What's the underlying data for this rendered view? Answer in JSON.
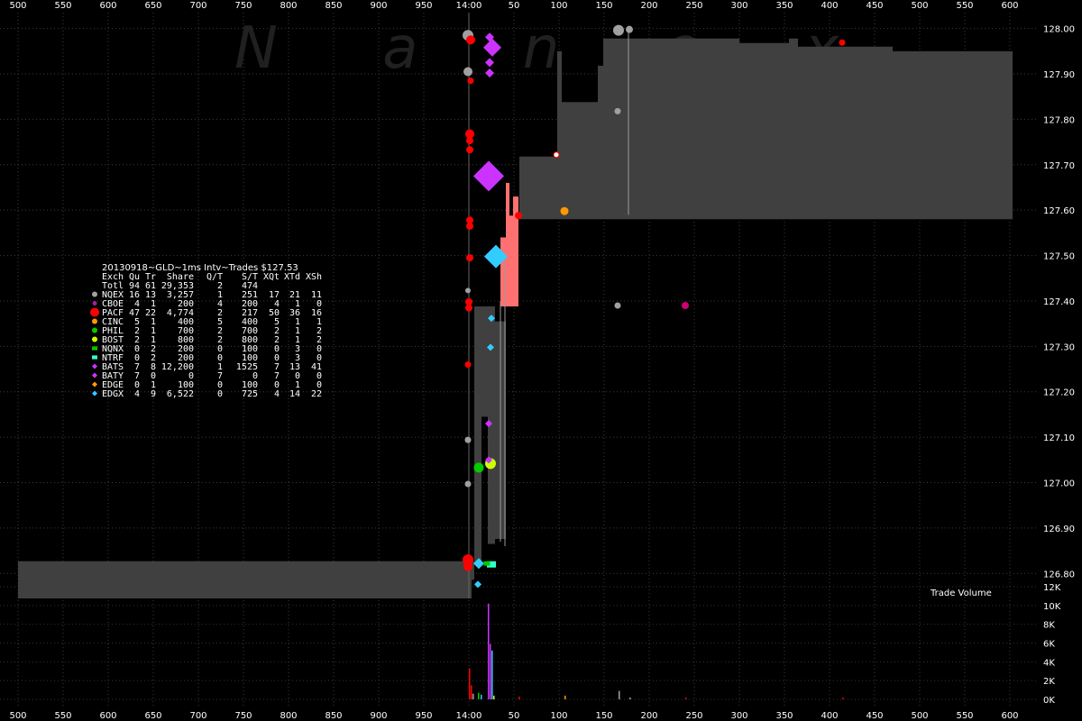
{
  "chart_data": {
    "type": "scatter",
    "title": "20130918~GLD~1ms Intv~Trades $127.53",
    "watermark": "N a n e x",
    "xlabel": "",
    "ylabel": "",
    "x_ticks_labels": [
      "500",
      "550",
      "600",
      "650",
      "700",
      "750",
      "800",
      "850",
      "900",
      "950",
      "14:00",
      "50",
      "100",
      "150",
      "200",
      "250",
      "300",
      "350",
      "400",
      "450",
      "500",
      "550",
      "600"
    ],
    "y_ticks": [
      128.0,
      127.9,
      127.8,
      127.7,
      127.6,
      127.5,
      127.4,
      127.3,
      127.2,
      127.1,
      127.0,
      126.9,
      126.8
    ],
    "y_tick_labels": [
      "128.00",
      "127.90",
      "127.80",
      "127.70",
      "127.60",
      "127.50",
      "127.40",
      "127.30",
      "127.20",
      "127.10",
      "127.00",
      "126.90",
      "126.80"
    ],
    "ylim": [
      126.745,
      128.035
    ],
    "volume_label": "Trade Volume",
    "volume_ticks": [
      "12K",
      "10K",
      "8K",
      "6K",
      "4K",
      "2K",
      "0K"
    ],
    "grid": true,
    "legend_placement": "left-middle",
    "table": {
      "header": [
        "Exch",
        "Qu",
        "Tr",
        "Share",
        "Q/T",
        "S/T",
        "XQt",
        "XTd",
        "XSh"
      ],
      "rows": [
        {
          "exch": "Totl",
          "qu": "94",
          "tr": "61",
          "share": "29,353",
          "qt": "2",
          "st": "474",
          "xqt": "",
          "xtd": "",
          "xsh": "",
          "color": "",
          "shape": "none"
        },
        {
          "exch": "NQEX",
          "qu": "16",
          "tr": "13",
          "share": "3,257",
          "qt": "1",
          "st": "251",
          "xqt": "17",
          "xtd": "21",
          "xsh": "11",
          "color": "#a0a0a0",
          "shape": "circle"
        },
        {
          "exch": "CBOE",
          "qu": "4",
          "tr": "1",
          "share": "200",
          "qt": "4",
          "st": "200",
          "xqt": "4",
          "xtd": "1",
          "xsh": "0",
          "color": "#a020a0",
          "shape": "circle-small"
        },
        {
          "exch": "PACF",
          "qu": "47",
          "tr": "22",
          "share": "4,774",
          "qt": "2",
          "st": "217",
          "xqt": "50",
          "xtd": "36",
          "xsh": "16",
          "color": "#ff0000",
          "shape": "circle-big"
        },
        {
          "exch": "CINC",
          "qu": "5",
          "tr": "1",
          "share": "400",
          "qt": "5",
          "st": "400",
          "xqt": "5",
          "xtd": "1",
          "xsh": "1",
          "color": "#ff9900",
          "shape": "circle"
        },
        {
          "exch": "PHIL",
          "qu": "2",
          "tr": "1",
          "share": "700",
          "qt": "2",
          "st": "700",
          "xqt": "2",
          "xtd": "1",
          "xsh": "2",
          "color": "#00cc00",
          "shape": "circle"
        },
        {
          "exch": "BOST",
          "qu": "2",
          "tr": "1",
          "share": "800",
          "qt": "2",
          "st": "800",
          "xqt": "2",
          "xtd": "1",
          "xsh": "2",
          "color": "#ccff00",
          "shape": "circle"
        },
        {
          "exch": "NQNX",
          "qu": "0",
          "tr": "2",
          "share": "200",
          "qt": "0",
          "st": "100",
          "xqt": "0",
          "xtd": "3",
          "xsh": "0",
          "color": "#00cc00",
          "shape": "square"
        },
        {
          "exch": "NTRF",
          "qu": "0",
          "tr": "2",
          "share": "200",
          "qt": "0",
          "st": "100",
          "xqt": "0",
          "xtd": "3",
          "xsh": "0",
          "color": "#33ffcc",
          "shape": "square"
        },
        {
          "exch": "BATS",
          "qu": "7",
          "tr": "8",
          "share": "12,200",
          "qt": "1",
          "st": "1525",
          "xqt": "7",
          "xtd": "13",
          "xsh": "41",
          "color": "#cc33ff",
          "shape": "diamond"
        },
        {
          "exch": "BATY",
          "qu": "7",
          "tr": "0",
          "share": "0",
          "qt": "7",
          "st": "0",
          "xqt": "7",
          "xtd": "0",
          "xsh": "0",
          "color": "#cc33ff",
          "shape": "diamond"
        },
        {
          "exch": "EDGE",
          "qu": "0",
          "tr": "1",
          "share": "100",
          "qt": "0",
          "st": "100",
          "xqt": "0",
          "xtd": "1",
          "xsh": "0",
          "color": "#ff9900",
          "shape": "diamond"
        },
        {
          "exch": "EDGX",
          "qu": "4",
          "tr": "9",
          "share": "6,522",
          "qt": "0",
          "st": "725",
          "xqt": "4",
          "xtd": "14",
          "xsh": "22",
          "color": "#33ccff",
          "shape": "diamond"
        }
      ]
    },
    "nbbo_band": [
      {
        "x0": 0,
        "x1": 503,
        "bid": 126.745,
        "ask": 126.827
      },
      {
        "x0": 503,
        "x1": 506,
        "bid": 126.786,
        "ask": 126.827
      },
      {
        "x0": 506,
        "x1": 514,
        "bid": 126.825,
        "ask": 127.388
      },
      {
        "x0": 514,
        "x1": 521,
        "bid": 127.145,
        "ask": 127.388
      },
      {
        "x0": 521,
        "x1": 529,
        "bid": 126.865,
        "ask": 127.388
      },
      {
        "x0": 529,
        "x1": 541,
        "bid": 126.876,
        "ask": 127.355
      },
      {
        "x0": 556,
        "x1": 598,
        "bid": 127.58,
        "ask": 127.718
      },
      {
        "x0": 598,
        "x1": 603,
        "bid": 127.58,
        "ask": 127.95
      },
      {
        "x0": 603,
        "x1": 643,
        "bid": 127.58,
        "ask": 127.838
      },
      {
        "x0": 643,
        "x1": 649,
        "bid": 127.58,
        "ask": 127.918
      },
      {
        "x0": 649,
        "x1": 800,
        "bid": 127.58,
        "ask": 127.978
      },
      {
        "x0": 800,
        "x1": 855,
        "bid": 127.58,
        "ask": 127.968
      },
      {
        "x0": 855,
        "x1": 865,
        "bid": 127.58,
        "ask": 127.978
      },
      {
        "x0": 865,
        "x1": 970,
        "bid": 127.58,
        "ask": 127.96
      },
      {
        "x0": 970,
        "x1": 1103,
        "bid": 127.58,
        "ask": 127.95
      }
    ],
    "crossed_band": [
      {
        "x0": 535,
        "x1": 541,
        "bid": 127.388,
        "ask": 127.54
      },
      {
        "x0": 541,
        "x1": 545,
        "bid": 127.388,
        "ask": 127.66
      },
      {
        "x0": 545,
        "x1": 549,
        "bid": 127.388,
        "ask": 127.588
      },
      {
        "x0": 549,
        "x1": 555,
        "bid": 127.388,
        "ask": 127.63
      }
    ],
    "lines": [
      {
        "x": 500,
        "y0": 126.745,
        "y1": 128.035,
        "color": "#666666"
      },
      {
        "x": 535,
        "y0": 126.87,
        "y1": 127.4,
        "color": "#9a9a9a"
      },
      {
        "x": 540,
        "y0": 126.86,
        "y1": 127.5,
        "color": "#9a9a9a"
      },
      {
        "x": 677,
        "y0": 127.59,
        "y1": 128.0,
        "color": "#9a9a9a"
      }
    ],
    "trades": [
      {
        "x": 499,
        "y": 127.985,
        "c": "#a0a0a0",
        "s": "circle",
        "r": 6
      },
      {
        "x": 499,
        "y": 127.905,
        "c": "#a0a0a0",
        "s": "circle",
        "r": 5
      },
      {
        "x": 499,
        "y": 127.423,
        "c": "#a0a0a0",
        "s": "circle",
        "r": 3
      },
      {
        "x": 499,
        "y": 127.094,
        "c": "#a0a0a0",
        "s": "circle",
        "r": 3.5
      },
      {
        "x": 499,
        "y": 126.997,
        "c": "#a0a0a0",
        "s": "circle",
        "r": 3.5
      },
      {
        "x": 665,
        "y": 127.818,
        "c": "#a0a0a0",
        "s": "circle",
        "r": 3.5
      },
      {
        "x": 665,
        "y": 127.39,
        "c": "#a0a0a0",
        "s": "circle",
        "r": 3.5
      },
      {
        "x": 666,
        "y": 127.996,
        "c": "#a0a0a0",
        "s": "circle",
        "r": 6
      },
      {
        "x": 678,
        "y": 127.998,
        "c": "#a0a0a0",
        "s": "circle",
        "r": 4
      },
      {
        "x": 502,
        "y": 127.975,
        "c": "#ff0000",
        "s": "circle",
        "r": 5
      },
      {
        "x": 502,
        "y": 127.885,
        "c": "#ff0000",
        "s": "circle",
        "r": 3.5
      },
      {
        "x": 501,
        "y": 127.768,
        "c": "#ff0000",
        "s": "circle",
        "r": 5
      },
      {
        "x": 501,
        "y": 127.753,
        "c": "#ff0000",
        "s": "circle",
        "r": 4
      },
      {
        "x": 501,
        "y": 127.733,
        "c": "#ff0000",
        "s": "circle",
        "r": 4
      },
      {
        "x": 501,
        "y": 127.578,
        "c": "#ff0000",
        "s": "circle",
        "r": 4
      },
      {
        "x": 501,
        "y": 127.565,
        "c": "#ff0000",
        "s": "circle",
        "r": 4
      },
      {
        "x": 501,
        "y": 127.495,
        "c": "#ff0000",
        "s": "circle",
        "r": 4
      },
      {
        "x": 500,
        "y": 127.398,
        "c": "#ff0000",
        "s": "circle",
        "r": 4
      },
      {
        "x": 500,
        "y": 127.385,
        "c": "#ff0000",
        "s": "circle",
        "r": 4
      },
      {
        "x": 499,
        "y": 127.26,
        "c": "#ff0000",
        "s": "circle",
        "r": 3.5
      },
      {
        "x": 499,
        "y": 126.83,
        "c": "#ff0000",
        "s": "circle",
        "r": 6
      },
      {
        "x": 499,
        "y": 126.815,
        "c": "#ff0000",
        "s": "circle",
        "r": 5
      },
      {
        "x": 555,
        "y": 127.588,
        "c": "#ff0000",
        "s": "circle",
        "r": 4
      },
      {
        "x": 597,
        "y": 127.722,
        "c": "#ff0000",
        "s": "circle-open",
        "r": 3
      },
      {
        "x": 914,
        "y": 127.969,
        "c": "#ff0000",
        "s": "circle",
        "r": 3.5
      },
      {
        "x": 740,
        "y": 127.39,
        "c": "#cc0077",
        "s": "circle",
        "r": 4
      },
      {
        "x": 606,
        "y": 127.598,
        "c": "#ff9900",
        "s": "circle",
        "r": 4.5
      },
      {
        "x": 511,
        "y": 127.033,
        "c": "#00cc00",
        "s": "circle",
        "r": 5.5
      },
      {
        "x": 524,
        "y": 127.042,
        "c": "#ccff00",
        "s": "circle",
        "r": 6
      },
      {
        "x": 526,
        "y": 127.958,
        "c": "#cc33ff",
        "s": "diamond",
        "r": 10
      },
      {
        "x": 523,
        "y": 127.981,
        "c": "#cc33ff",
        "s": "diamond",
        "r": 5
      },
      {
        "x": 523,
        "y": 127.925,
        "c": "#cc33ff",
        "s": "diamond",
        "r": 5
      },
      {
        "x": 523,
        "y": 127.902,
        "c": "#cc33ff",
        "s": "diamond",
        "r": 5
      },
      {
        "x": 522,
        "y": 127.675,
        "c": "#cc33ff",
        "s": "diamond",
        "r": 17
      },
      {
        "x": 522,
        "y": 127.13,
        "c": "#cc33ff",
        "s": "diamond",
        "r": 4
      },
      {
        "x": 522,
        "y": 127.05,
        "c": "#cc33ff",
        "s": "diamond",
        "r": 4
      },
      {
        "x": 530,
        "y": 127.498,
        "c": "#33ccff",
        "s": "diamond",
        "r": 13
      },
      {
        "x": 525,
        "y": 127.362,
        "c": "#33ccff",
        "s": "diamond",
        "r": 4
      },
      {
        "x": 524,
        "y": 127.298,
        "c": "#33ccff",
        "s": "diamond",
        "r": 4
      },
      {
        "x": 511,
        "y": 126.822,
        "c": "#33ccff",
        "s": "diamond",
        "r": 6
      },
      {
        "x": 510,
        "y": 126.776,
        "c": "#33ccff",
        "s": "diamond",
        "r": 4
      },
      {
        "x": 525,
        "y": 126.82,
        "c": "#33ffcc",
        "s": "square",
        "r": 5
      },
      {
        "x": 520,
        "y": 126.822,
        "c": "#00cc00",
        "s": "square",
        "r": 3.5
      }
    ],
    "volume_bars": [
      {
        "x": 500,
        "h": 3300,
        "c": "#ff0000"
      },
      {
        "x": 502,
        "h": 1500,
        "c": "#ff0000"
      },
      {
        "x": 504,
        "h": 600,
        "c": "#a0a0a0"
      },
      {
        "x": 510,
        "h": 700,
        "c": "#00cc00"
      },
      {
        "x": 513,
        "h": 500,
        "c": "#33ccff"
      },
      {
        "x": 521,
        "h": 10200,
        "c": "#cc33ff"
      },
      {
        "x": 523,
        "h": 5900,
        "c": "#cc33ff"
      },
      {
        "x": 525,
        "h": 5200,
        "c": "#33ccff"
      },
      {
        "x": 527,
        "h": 400,
        "c": "#ccff00"
      },
      {
        "x": 555,
        "h": 300,
        "c": "#ff0000"
      },
      {
        "x": 606,
        "h": 400,
        "c": "#ff9900"
      },
      {
        "x": 666,
        "h": 900,
        "c": "#a0a0a0"
      },
      {
        "x": 678,
        "h": 200,
        "c": "#a0a0a0"
      },
      {
        "x": 740,
        "h": 200,
        "c": "#cc0077"
      },
      {
        "x": 914,
        "h": 200,
        "c": "#ff0000"
      }
    ],
    "volume_ylim": [
      0,
      12000
    ]
  }
}
